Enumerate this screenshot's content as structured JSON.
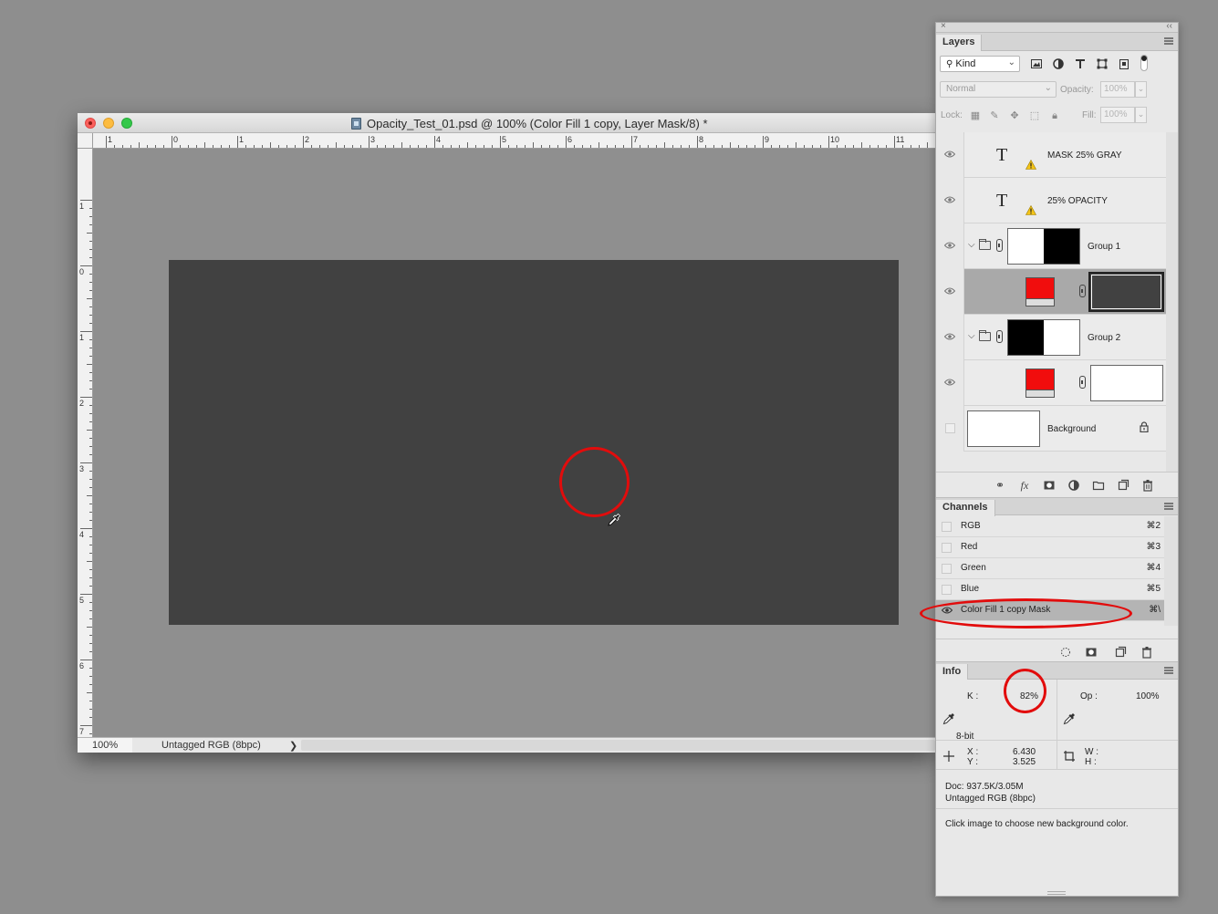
{
  "document": {
    "title": "Opacity_Test_01.psd @ 100% (Color Fill 1 copy, Layer Mask/8) *",
    "zoom": "100%",
    "color_profile": "Untagged RGB (8bpc)",
    "status_arrow": "❯",
    "ruler_h_labels": [
      "1",
      "0",
      "1",
      "2",
      "3",
      "4",
      "5",
      "6",
      "7",
      "8",
      "9",
      "10",
      "11"
    ],
    "ruler_v_labels": [
      "1",
      "0",
      "1",
      "2",
      "3",
      "4",
      "5",
      "6",
      "7"
    ],
    "canvas_color": "#414141"
  },
  "panel_top": {
    "close": "×",
    "collapse": "‹‹"
  },
  "layers_panel": {
    "tab": "Layers",
    "filter_kind": "Kind",
    "blend_mode": "Normal",
    "opacity_label": "Opacity:",
    "opacity_value": "100%",
    "lock_label": "Lock:",
    "fill_label": "Fill:",
    "fill_value": "100%",
    "layers": [
      {
        "name": "MASK 25% GRAY"
      },
      {
        "name": "25% OPACITY"
      },
      {
        "name": "Group 1"
      },
      {
        "name": ""
      },
      {
        "name": "Group 2"
      },
      {
        "name": ""
      },
      {
        "name": "Background"
      }
    ]
  },
  "channels_panel": {
    "tab": "Channels",
    "channels": [
      {
        "name": "RGB",
        "shortcut": "⌘2"
      },
      {
        "name": "Red",
        "shortcut": "⌘3"
      },
      {
        "name": "Green",
        "shortcut": "⌘4"
      },
      {
        "name": "Blue",
        "shortcut": "⌘5"
      },
      {
        "name": "Color Fill 1 copy Mask",
        "shortcut": "⌘\\"
      }
    ]
  },
  "info_panel": {
    "tab": "Info",
    "k_label": "K :",
    "k_value": "82%",
    "op_label": "Op :",
    "op_value": "100%",
    "bit_depth": "8-bit",
    "x_label": "X :",
    "x_value": "6.430",
    "y_label": "Y :",
    "y_value": "3.525",
    "w_label": "W :",
    "h_label": "H :",
    "doc_size": "Doc: 937.5K/3.05M",
    "profile": "Untagged RGB (8bpc)",
    "hint": "Click image to choose new background color."
  },
  "colors": {
    "highlight_ring": "#e20c0c",
    "fill_swatch": "#f10d0d"
  }
}
